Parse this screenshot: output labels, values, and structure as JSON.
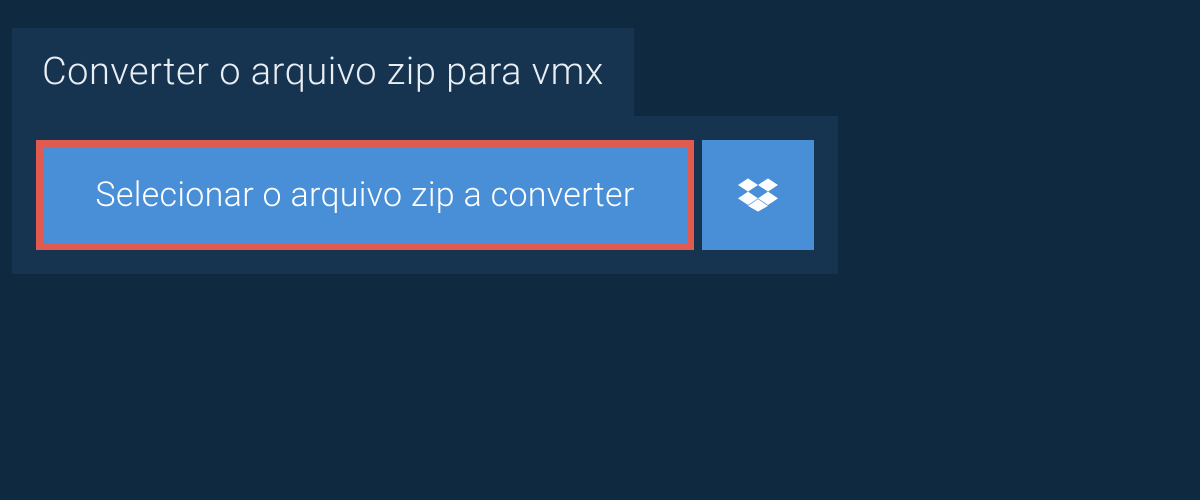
{
  "tab": {
    "title": "Converter o arquivo zip para vmx"
  },
  "actions": {
    "select_file_label": "Selecionar o arquivo zip a converter"
  },
  "colors": {
    "background": "#0f2941",
    "panel": "#163450",
    "button": "#488fd8",
    "highlight_border": "#e05a4f",
    "text_light": "#e8eef4",
    "text_white": "#ffffff"
  }
}
